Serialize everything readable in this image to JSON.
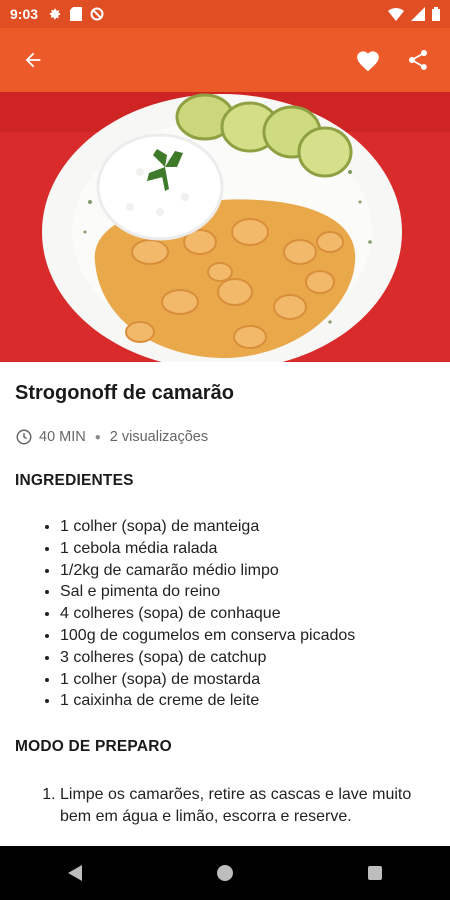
{
  "status_bar": {
    "time": "9:03"
  },
  "recipe": {
    "title": "Strogonoff de camarão",
    "time": "40 MIN",
    "views": "2 visualizações"
  },
  "sections": {
    "ingredients_heading": "INGREDIENTES",
    "method_heading": "MODO DE PREPARO"
  },
  "ingredients": [
    "1 colher (sopa) de manteiga",
    "1 cebola média ralada",
    "1/2kg de camarão médio limpo",
    "Sal e pimenta do reino",
    "4 colheres (sopa) de conhaque",
    "100g de cogumelos em conserva picados",
    "3 colheres (sopa) de catchup",
    "1 colher (sopa) de mostarda",
    "1 caixinha de creme de leite"
  ],
  "steps": [
    "Limpe os camarões, retire as cascas e lave muito bem em água e limão, escorra e reserve."
  ],
  "colors": {
    "status_bar": "#e04e23",
    "app_bar": "#eb5a28",
    "nav_bar": "#000000"
  },
  "icons": [
    "settings-icon",
    "sd-card-icon",
    "no-sync-icon",
    "wifi-icon",
    "signal-icon",
    "battery-icon",
    "back-arrow-icon",
    "heart-icon",
    "share-icon",
    "clock-icon",
    "nav-back-icon",
    "nav-home-icon",
    "nav-recents-icon"
  ]
}
